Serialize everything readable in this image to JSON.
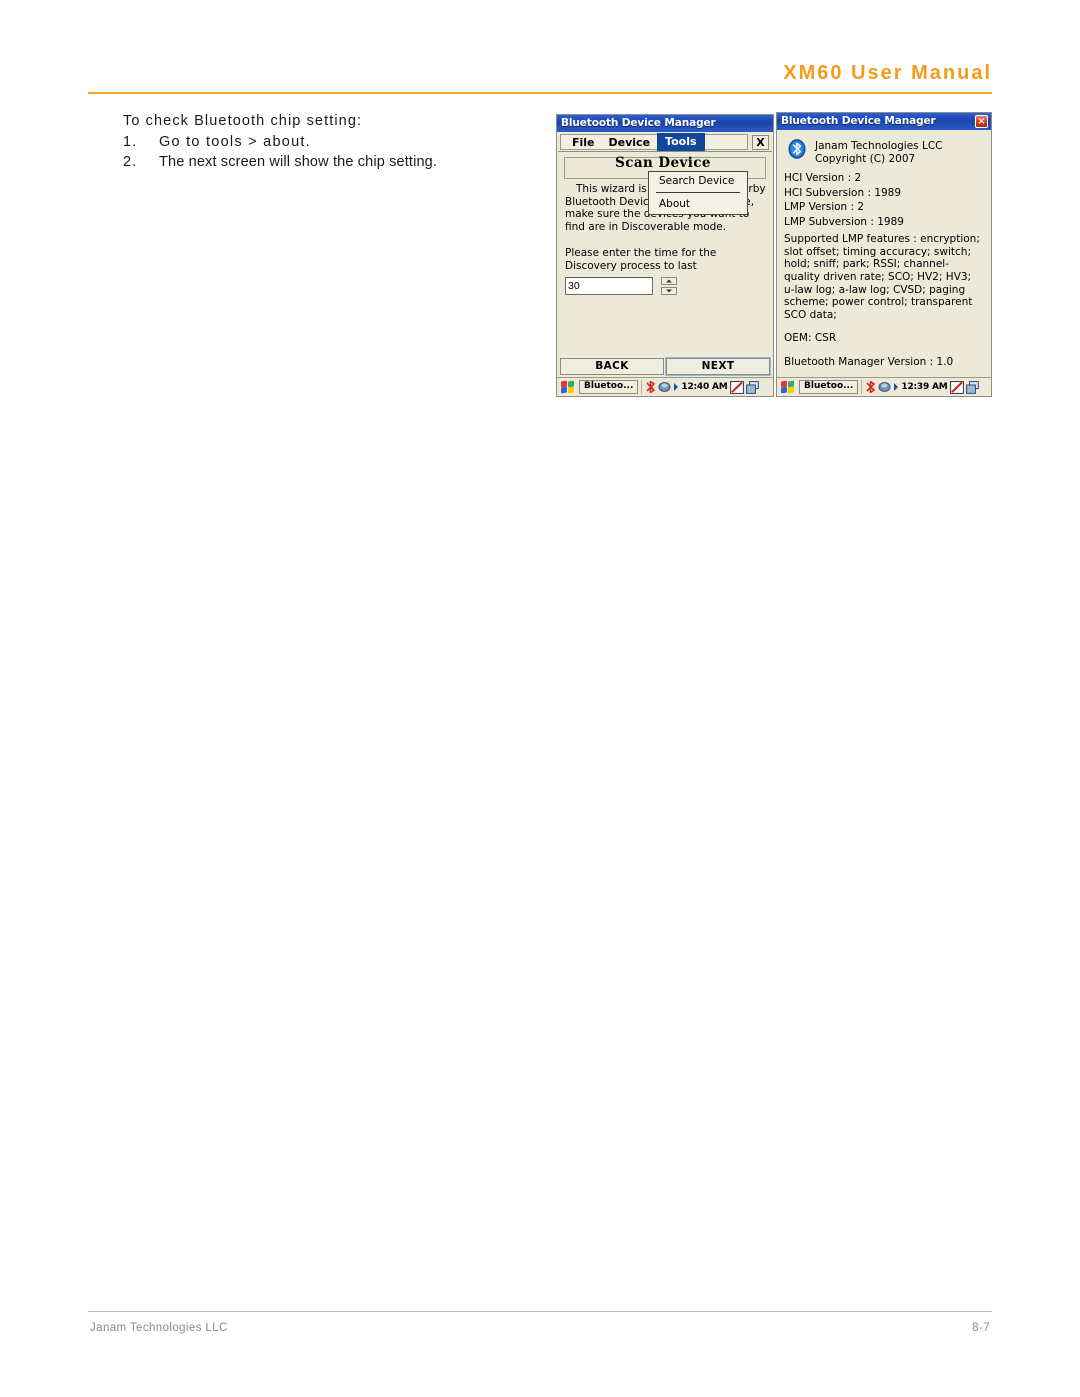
{
  "page": {
    "header_title": "XM60 User Manual",
    "accent_color": "#F5A623",
    "footer_left": "Janam Technologies LLC",
    "footer_right": "8-7"
  },
  "instructions": {
    "heading": "To check Bluetooth chip setting:",
    "steps": [
      {
        "num": "1.",
        "text": "Go to tools > about."
      },
      {
        "num": "2.",
        "text": "The next screen will show the chip setting."
      }
    ]
  },
  "screenshot_left": {
    "titlebar": {
      "title": "Bluetooth Device Manager"
    },
    "menubar": {
      "items": [
        {
          "label": "File",
          "active": false
        },
        {
          "label": "Device",
          "active": false
        },
        {
          "label": "Tools",
          "active": true
        }
      ],
      "close_label": "X"
    },
    "dropdown": {
      "items": [
        {
          "label": "Search Device"
        },
        {
          "label": "About"
        }
      ]
    },
    "wizard": {
      "group_title": "Scan Device",
      "paragraph": "This wizard is meant to scan nearby Bluetooth Devices. Before continue, make sure the devices you want to find are in Discoverable mode.",
      "prompt": "Please enter the time for the Discovery process to last",
      "duration_value": "30",
      "duration_placeholder": "30",
      "spinner_up": "increment-arrow",
      "spinner_down": "decrement-arrow"
    },
    "buttons": {
      "back": "BACK",
      "next": "NEXT"
    },
    "taskbar": {
      "start_icon": "windows-start-icon",
      "task_label": "Bluetoo...",
      "tray_icons": [
        "bluetooth-tray-icon",
        "network-tray-icon",
        "arrow-tray-icon",
        "pen-input-icon",
        "windows-tray-icon"
      ],
      "clock": "12:40 AM"
    }
  },
  "screenshot_right": {
    "titlebar": {
      "title": "Bluetooth Device Manager",
      "close_label": "×"
    },
    "about": {
      "logo_icon": "bluetooth-logo-icon",
      "company": "Janam Technologies LCC",
      "copyright": "Copyright (C) 2007",
      "lines": [
        "HCI Version : 2",
        "HCI Subversion : 1989",
        "LMP Version : 2",
        "LMP Subversion : 1989"
      ],
      "features_block": "Supported LMP features : encryption; slot offset; timing accuracy; switch; hold; sniff; park; RSSI; channel-quality driven rate; SCO; HV2; HV3; u-law log; a-law log; CVSD; paging scheme; power control; transparent SCO data;",
      "oem": "OEM: CSR",
      "manager_version": "Bluetooth Manager Version : 1.0"
    },
    "taskbar": {
      "start_icon": "windows-start-icon",
      "task_label": "Bluetoo...",
      "tray_icons": [
        "bluetooth-tray-icon",
        "network-tray-icon",
        "arrow-tray-icon",
        "pen-input-icon",
        "windows-tray-icon"
      ],
      "clock": "12:39 AM"
    }
  }
}
